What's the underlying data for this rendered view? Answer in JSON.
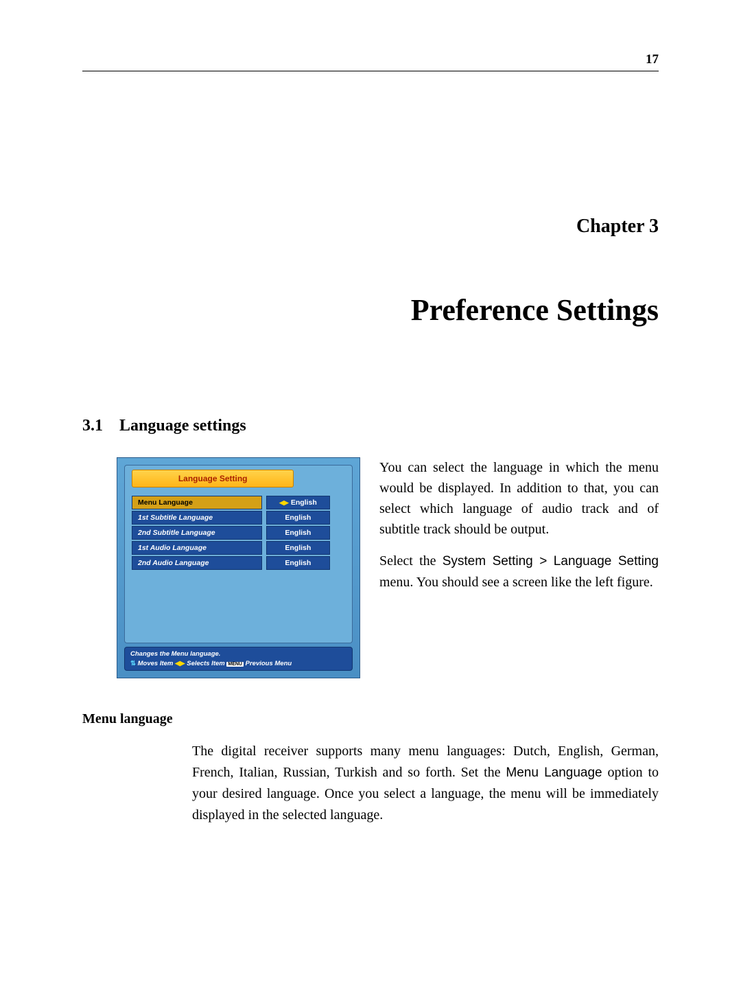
{
  "page_number": "17",
  "chapter_label": "Chapter 3",
  "chapter_title": "Preference Settings",
  "section_number": "3.1",
  "section_title": "Language settings",
  "screenshot": {
    "title": "Language Setting",
    "rows": [
      {
        "label": "Menu Language",
        "value": "English",
        "selected": true,
        "arrows": true
      },
      {
        "label": "1st Subtitle Language",
        "value": "English",
        "selected": false,
        "arrows": false
      },
      {
        "label": "2nd Subtitle Language",
        "value": "English",
        "selected": false,
        "arrows": false
      },
      {
        "label": "1st Audio Language",
        "value": "English",
        "selected": false,
        "arrows": false
      },
      {
        "label": "2nd Audio Language",
        "value": "English",
        "selected": false,
        "arrows": false
      }
    ],
    "help_line": "Changes the Menu language.",
    "nav_moves": "Moves Item",
    "nav_selects": "Selects Item",
    "nav_menu_label": "MENU",
    "nav_previous": "Previous Menu"
  },
  "intro_para1": "You can select the language in which the menu would be displayed. In addition to that, you can select which language of audio track and of subtitle track should be output.",
  "intro_para2_pre": "Select the ",
  "intro_para2_path": "System Setting > Language Setting",
  "intro_para2_post": " menu. You should see a screen like the left figure.",
  "subheading": "Menu language",
  "body_pre": "The digital receiver supports many menu languages: Dutch, English, German, French, Italian, Russian, Turkish and so forth. Set the ",
  "body_option": "Menu Language",
  "body_post": " option to your desired language. Once you select a language, the menu will be immediately displayed in the selected language."
}
